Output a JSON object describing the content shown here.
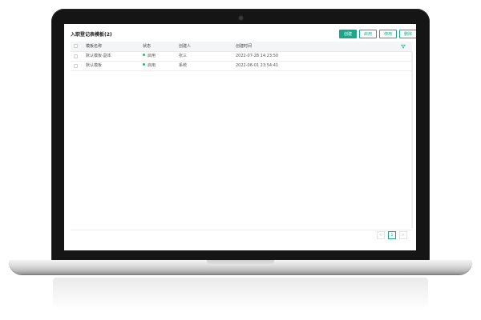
{
  "screen": {
    "title": "入职登记表模板(2)",
    "actions": {
      "create": "创建",
      "enable": "启用",
      "disable": "停用",
      "delete": "删除"
    }
  },
  "table": {
    "columns": [
      "模板名称",
      "状态",
      "创建人",
      "创建时间"
    ],
    "rows": [
      {
        "name": "默认模板-副本",
        "status": "启用",
        "creator": "张三",
        "time": "2022-07-28 14:23:50"
      },
      {
        "name": "默认模板",
        "status": "启用",
        "creator": "系统",
        "time": "2022-06-01 23:54:41"
      }
    ]
  },
  "pagination": {
    "prev": "<",
    "current": "1",
    "next": ">"
  },
  "colors": {
    "accent": "#1aa88a",
    "status_enabled": "#2bb673"
  }
}
